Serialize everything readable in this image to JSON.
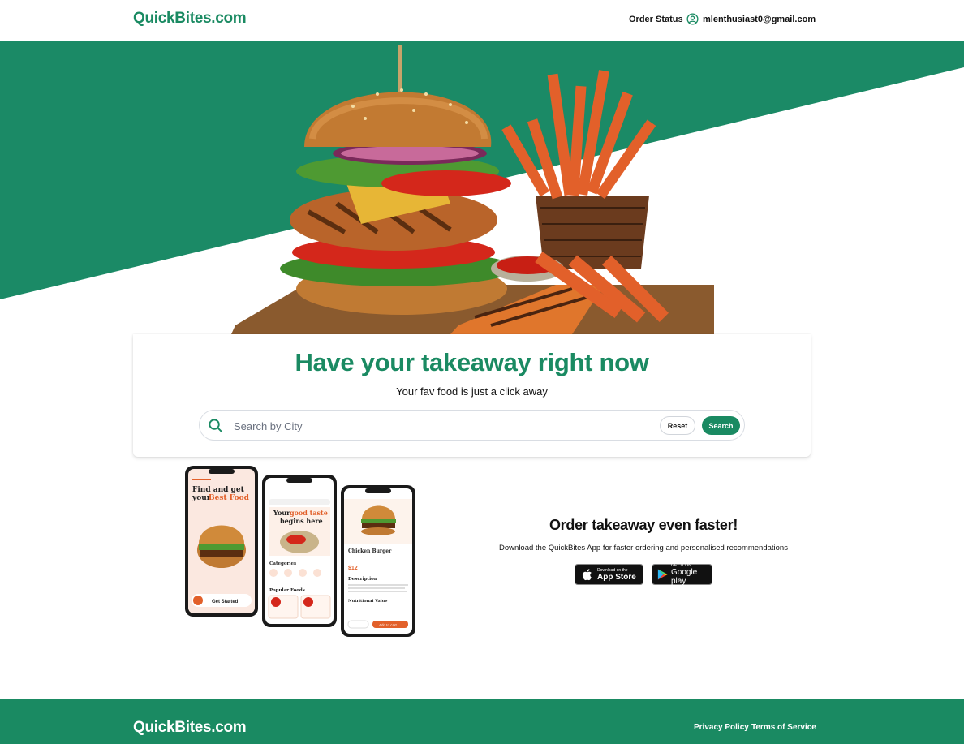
{
  "header": {
    "logo": "QuickBites.com",
    "order_status": "Order Status",
    "user_email": "mlenthusiast0@gmail.com"
  },
  "hero": {
    "headline": "Have your takeaway right now",
    "subline": "Your fav food is just a click away"
  },
  "search": {
    "placeholder": "Search by City",
    "reset_label": "Reset",
    "search_label": "Search"
  },
  "promo": {
    "title": "Order takeaway even faster!",
    "text": "Download the QuickBites App for faster ordering and personalised recommendations",
    "app_store_small": "Download on the",
    "app_store_big": "App Store",
    "google_play_small": "GET IT ON",
    "google_play_big": "Google play"
  },
  "phones": {
    "phone1_title_a": "Find and get",
    "phone1_title_b": "your",
    "phone1_title_c": "Best Food",
    "phone1_cta": "Get Started",
    "phone2_title_a": "Your",
    "phone2_title_b": "good taste",
    "phone2_title_c": "begins here",
    "phone2_categories": "Categories",
    "phone2_popular": "Popular Foods",
    "phone3_item": "Chicken Burger",
    "phone3_price": "$12",
    "phone3_description": "Description",
    "phone3_nutrition": "Nutritional Value",
    "phone3_add": "Add to cart"
  },
  "footer": {
    "logo": "QuickBites.com",
    "privacy": "Privacy Policy",
    "terms": "Terms of Service"
  },
  "colors": {
    "brand": "#1a8a62",
    "text": "#111111"
  }
}
